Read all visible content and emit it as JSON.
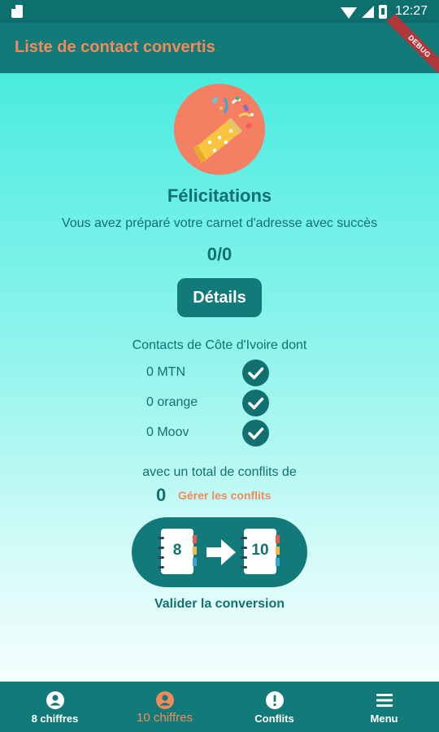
{
  "status_bar": {
    "time": "12:27"
  },
  "app_bar": {
    "title": "Liste de contact convertis",
    "debug_banner": "DEBUG"
  },
  "main": {
    "headline": "Félicitations",
    "subtext": "Vous avez préparé votre carnet d'adresse avec succès",
    "count": "0/0",
    "details_button": "Détails",
    "contacts_heading": "Contacts de Côte d'Ivoire dont",
    "operators": [
      {
        "label": "0 MTN",
        "checked": true
      },
      {
        "label": "0 orange",
        "checked": true
      },
      {
        "label": "0 Moov",
        "checked": true
      }
    ],
    "conflicts_text": "avec un total de conflits de",
    "conflict_count": "0",
    "manage_conflicts": "Gérer les conflits",
    "from_digits": "8",
    "to_digits": "10",
    "validate_label": "Valider la conversion"
  },
  "bottom_nav": {
    "items": [
      {
        "label": "8 chiffres",
        "icon": "account-circle-icon",
        "active": false
      },
      {
        "label": "10 chiffres",
        "icon": "account-circle-icon",
        "active": true
      },
      {
        "label": "Conflits",
        "icon": "alert-circle-icon",
        "active": false
      },
      {
        "label": "Menu",
        "icon": "menu-icon",
        "active": false
      }
    ]
  },
  "colors": {
    "primary": "#127a78",
    "accent": "#f28b5b",
    "text": "#127070",
    "party_circle": "#f47f62"
  }
}
